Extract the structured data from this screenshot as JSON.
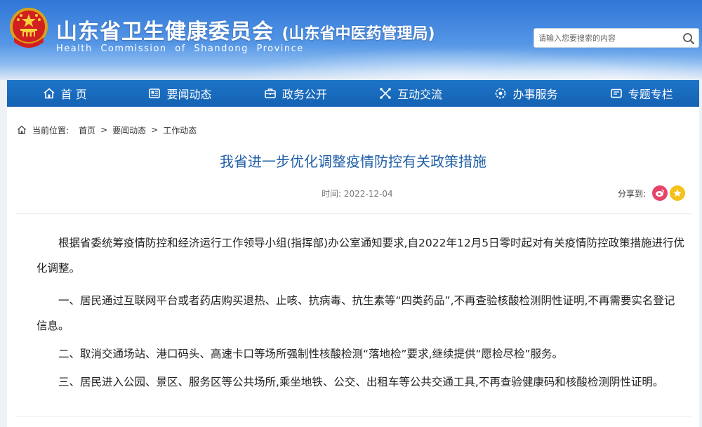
{
  "header": {
    "title": "山东省卫生健康委员会",
    "subtitle": "(山东省中医药管理局)",
    "english": "Health Commission of Shandong Province",
    "search": {
      "placeholder": "请输入您要搜索的内容"
    }
  },
  "nav": {
    "items": [
      {
        "label": "首 页",
        "icon": "home-icon"
      },
      {
        "label": "要闻动态",
        "icon": "news-icon"
      },
      {
        "label": "政务公开",
        "icon": "briefcase-icon"
      },
      {
        "label": "互动交流",
        "icon": "interaction-icon"
      },
      {
        "label": "办事服务",
        "icon": "service-icon"
      },
      {
        "label": "专题专栏",
        "icon": "topic-icon"
      }
    ]
  },
  "breadcrumb": {
    "label": "当前位置:",
    "items": [
      "首页",
      "要闻动态",
      "工作动态"
    ],
    "separator": ">"
  },
  "article": {
    "title": "我省进一步优化调整疫情防控有关政策措施",
    "date": "时间: 2022-12-04",
    "share_label": "分享到:",
    "paragraphs": [
      "根据省委统筹疫情防控和经济运行工作领导小组(指挥部)办公室通知要求,自2022年12月5日零时起对有关疫情防控政策措施进行优化调整。",
      "一、居民通过互联网平台或者药店购买退热、止咳、抗病毒、抗生素等“四类药品”,不再查验核酸检测阴性证明,不再需要实名登记信息。",
      "二、取消交通场站、港口码头、高速卡口等场所强制性核酸检测“落地检”要求,继续提供“愿检尽检”服务。",
      "三、居民进入公园、景区、服务区等公共场所,乘坐地铁、公交、出租车等公共交通工具,不再查验健康码和核酸检测阴性证明。"
    ]
  },
  "colors": {
    "nav_bg": "#1668b8",
    "title_blue": "#1f5fa8",
    "weibo": "#e6446b",
    "share_gold": "#f5c21b"
  }
}
